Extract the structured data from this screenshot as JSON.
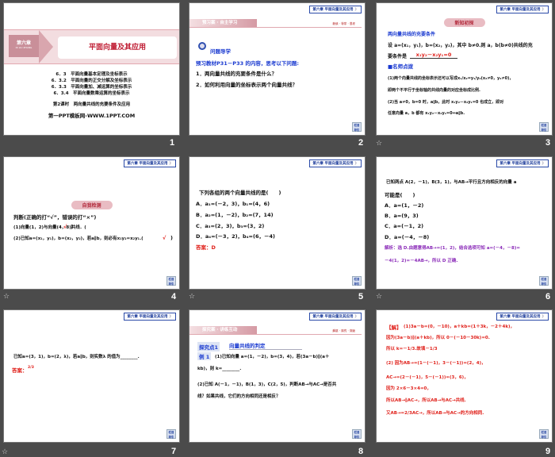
{
  "common": {
    "chapter_badge": "第六章 平面向量及其应用",
    "nav_button": "栏目导引",
    "star": "☆"
  },
  "slides": [
    {
      "number": "1",
      "chapter_tag": "第六章",
      "chapter_pinyin": "DI LIU ZHANG",
      "title": "平面向量及其应用",
      "lines": [
        "6．3　平面向量基本定理及坐标表示",
        "6．3.2　平面向量的正交分解及坐标表示",
        "6．3.3　平面向量加、减运算的坐标表示",
        "6．3.4　平面向量数乘运算的坐标表示"
      ],
      "lesson": "第2课时　两向量共线的充要条件及应用",
      "site": "第一PPT模板网-WWW.1PPT.COM"
    },
    {
      "number": "2",
      "section": "预习案 · 自主学习",
      "section_sub": "新读 · 导学 · 思考",
      "heading": "问题导学",
      "intro": "预习教材P31－P33 的内容，思考以下问题:",
      "questions": [
        "1．两向量共线的充要条件是什么？",
        "2．如何利用向量的坐标表示两个向量共线？"
      ]
    },
    {
      "number": "3",
      "pill": "新知初探",
      "heading": "两向量共线的充要条件",
      "lines": [
        "设 a=(x₁，y₁)，b=(x₂，y₂)，其中 b≠0.则 a，b(b≠0)共线的充",
        "要条件是"
      ],
      "answer": "x₁y₂－x₂y₁=0",
      "tip": "■名师点拨",
      "notes": [
        "(1)两个向量共线的坐标表示还可以写成x₁/x₂=y₁/y₂(x₂≠0，y₂≠0)，",
        "即两个不平行于坐标轴的共线向量的对应坐标成比例.",
        "(2)当 a≠0，b=0 时，a∥b，此时 x₁y₂－x₂y₁=0 也成立，即对",
        "任意向量 a，b 都有 x₁y₂－x₂y₁=0⇔a∥b."
      ]
    },
    {
      "number": "4",
      "pill": "自我检测",
      "q": "判断(正确的打“√”，错误的打“×”)",
      "items": [
        "(1)向量(1，2)与向量(4，8)共线．(",
        "(2)已知a=(x₁，y₁)，b=(x₂，y₂)，若a∥b，则必有x₁y₂=x₂y₁.("
      ],
      "mark": "√"
    },
    {
      "number": "5",
      "q": "下列各组的两个向量共线的是(　　)",
      "options": [
        "A．a₁=(－2，3)，b₁=(4，6)",
        "B．a₂=(1，－2)，b₂=(7，14)",
        "C．a₃=(2，3)，b₃=(3，2)",
        "D．a₄=(－3，2)，b₄=(6，－4)"
      ],
      "answer": "答案：D"
    },
    {
      "number": "6",
      "q": [
        "已知两点 A(2，－1)，B(3，1)，与AB→平行且方向相反的向量 a",
        "可能是(　　)"
      ],
      "options": [
        "A．a=(1，－2)",
        "B．a=(9，3)",
        "C．a=(－1，2)",
        "D．a=(－4，－8)"
      ],
      "analysis": [
        "解析：选 D.由题意得AB→=(1，2)，结合选项可知 a=(－4，－8)=",
        "－4(1，2)=－4AB→，所以 D 正确."
      ]
    },
    {
      "number": "7",
      "q": "已知a=(3，1)，b=(2，λ)，若a∥b，则实数λ 的值为________.",
      "answer_label": "答案：",
      "answer": "2/3"
    },
    {
      "number": "8",
      "section": "探究案 · 讲练互动",
      "section_sub": "解惑 · 探究 · 突破",
      "point_label": "探究点1",
      "point_title": "向量共线的判定",
      "example": "例 1",
      "lines": [
        "(1)已知向量 a=(1，－2)，b=(3，4)，若(3a－b)∥(a＋",
        "kb)，则 k=________.",
        "(2)已知 A(－1，－1)，B(1，3)，C(2，5)，判断AB→与AC→是否共",
        "线？如果共线，它们的方向相同还是相反？"
      ]
    },
    {
      "number": "9",
      "solution_label": "【解】",
      "lines": [
        "(1)3a－b=(0，－10)，a＋kb=(1＋3k，－2＋4k)，",
        "因为(3a－b)∥(a＋kb)，所以 0－(－10－30k)=0.",
        "所以 k=－1/3.故填－1/3",
        "(2) 因为AB→=(1－(－1)，3－(－1))=(2，4)，",
        "AC→=(2－(－1)，5－(－1))=(3，6)，",
        "因为 2×6－3×4=0，",
        "所以AB→∥AC→，所以AB→与AC→共线.",
        "又AB→=2/3AC→，所以AB→与AC→的方向相同."
      ]
    }
  ]
}
